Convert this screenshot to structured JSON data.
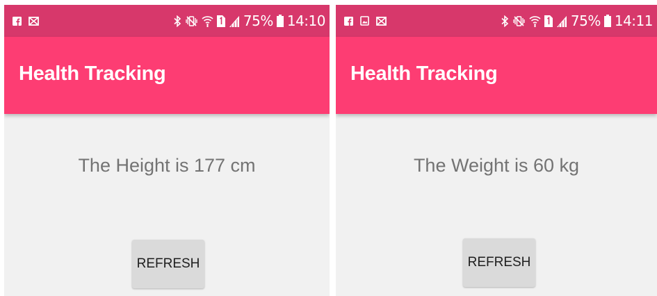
{
  "theme": {
    "status_bar_color": "#d7386b",
    "app_bar_color": "#fd3d73",
    "background": "#f1f1f1",
    "reading_text_color": "#737373",
    "button_color": "#dadada"
  },
  "screens": [
    {
      "status_bar": {
        "notification_icons": [
          "facebook-icon",
          "email-icon"
        ],
        "system_icons": [
          "bluetooth-icon",
          "vibrate-icon",
          "wifi-icon",
          "sim-1-icon",
          "signal-icon",
          "battery-icon"
        ],
        "battery_percent": "75%",
        "time": "14:10"
      },
      "app_bar": {
        "title": "Health Tracking"
      },
      "reading": "The Height is 177 cm",
      "refresh_label": "REFRESH"
    },
    {
      "status_bar": {
        "notification_icons": [
          "facebook-icon",
          "gallery-icon",
          "email-icon"
        ],
        "system_icons": [
          "bluetooth-icon",
          "vibrate-icon",
          "wifi-icon",
          "sim-1-icon",
          "signal-icon",
          "battery-icon"
        ],
        "battery_percent": "75%",
        "time": "14:11"
      },
      "app_bar": {
        "title": "Health Tracking"
      },
      "reading": "The Weight is 60 kg",
      "refresh_label": "REFRESH"
    }
  ]
}
